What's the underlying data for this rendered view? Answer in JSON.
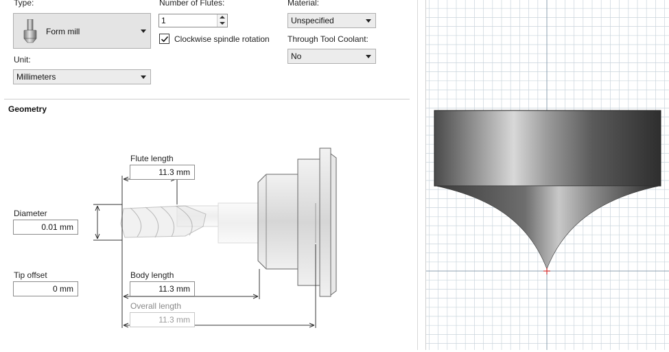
{
  "tool": {
    "type_label": "Type:",
    "type_value": "Form mill",
    "unit_label": "Unit:",
    "unit_value": "Millimeters",
    "flutes_label": "Number of Flutes:",
    "flutes_value": "1",
    "clockwise_label": "Clockwise spindle rotation",
    "clockwise_checked": true,
    "material_label": "Material:",
    "material_value": "Unspecified",
    "coolant_label": "Through Tool Coolant:",
    "coolant_value": "No"
  },
  "geometry": {
    "section_title": "Geometry",
    "flute_length_label": "Flute length",
    "flute_length_value": "11.3 mm",
    "diameter_label": "Diameter",
    "diameter_value": "0.01 mm",
    "tip_offset_label": "Tip offset",
    "tip_offset_value": "0 mm",
    "body_length_label": "Body length",
    "body_length_value": "11.3 mm",
    "overall_length_label": "Overall length",
    "overall_length_value": "11.3 mm"
  },
  "colors": {
    "grid_line": "#c9d4dc",
    "axis_line": "#8ea0b0",
    "origin_marker": "#d32f2f"
  },
  "icons": {
    "type_icon": "end-mill-tool-icon",
    "combo_arrow": "chevron-down-icon",
    "check": "checkmark-icon"
  }
}
